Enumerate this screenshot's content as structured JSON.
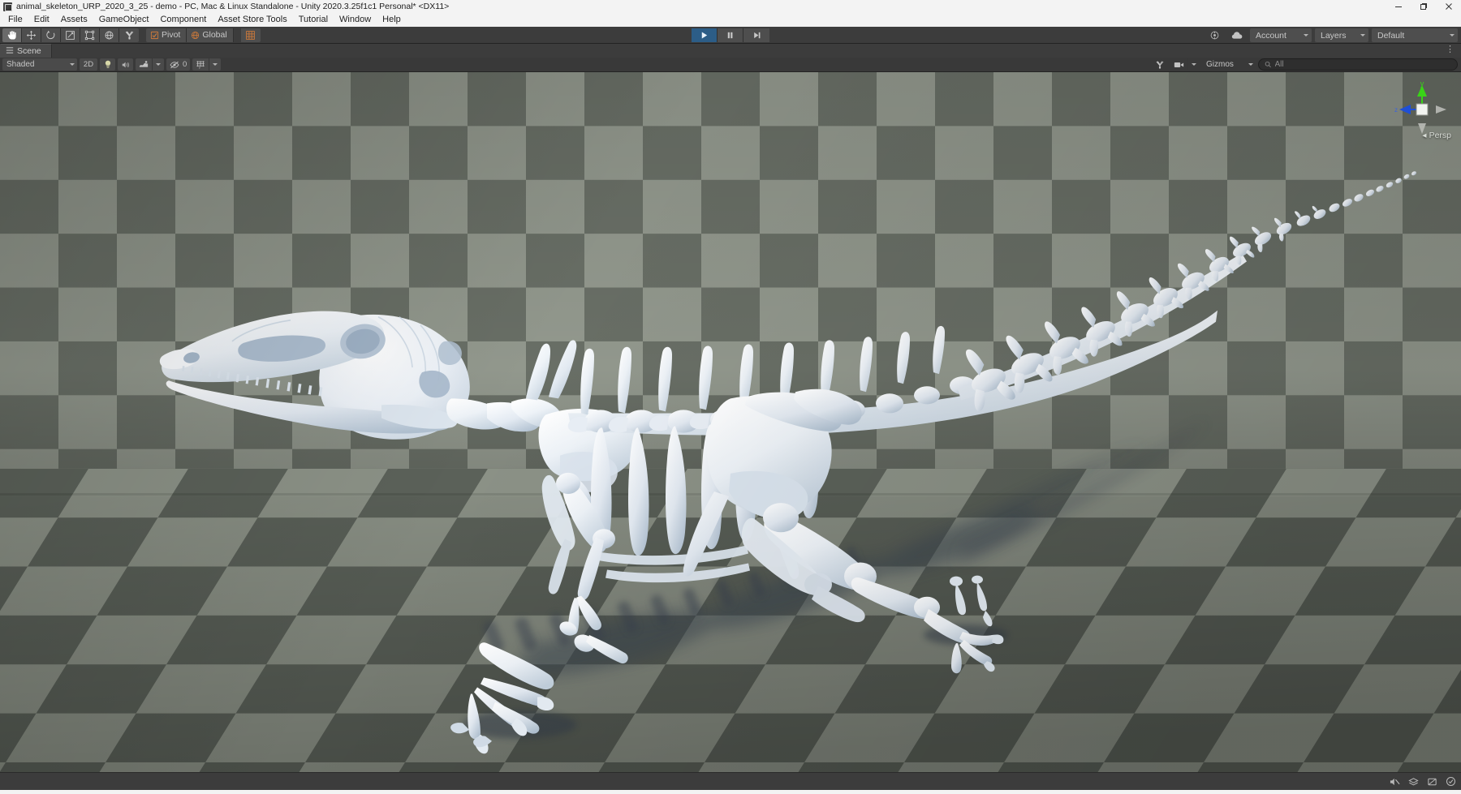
{
  "window": {
    "title": "animal_skeleton_URP_2020_3_25 - demo - PC, Mac & Linux Standalone - Unity 2020.3.25f1c1 Personal* <DX11>",
    "icon": "unity-app-icon",
    "minimize_label": "─",
    "maximize_label": "❐",
    "close_label": "✕"
  },
  "menubar": {
    "items": [
      {
        "label": "File"
      },
      {
        "label": "Edit"
      },
      {
        "label": "Assets"
      },
      {
        "label": "GameObject"
      },
      {
        "label": "Component"
      },
      {
        "label": "Asset Store Tools"
      },
      {
        "label": "Tutorial"
      },
      {
        "label": "Window"
      },
      {
        "label": "Help"
      }
    ]
  },
  "toolbar": {
    "tools": [
      {
        "name": "hand-tool",
        "icon": "hand-icon",
        "active": true
      },
      {
        "name": "move-tool",
        "icon": "move-icon",
        "active": false
      },
      {
        "name": "rotate-tool",
        "icon": "rotate-icon",
        "active": false
      },
      {
        "name": "scale-tool",
        "icon": "scale-icon",
        "active": false
      },
      {
        "name": "rect-tool",
        "icon": "rect-transform-icon",
        "active": false
      },
      {
        "name": "transform-tool",
        "icon": "transform-icon",
        "active": false
      },
      {
        "name": "custom-editor-tool",
        "icon": "wrench-icon",
        "active": false
      }
    ],
    "pivot_label": "Pivot",
    "handle_label": "Global",
    "snap_icon": "grid-snap-icon",
    "play_label": "Play",
    "pause_label": "Pause",
    "step_label": "Step",
    "play_active": true,
    "cloud_icon": "cloud-icon",
    "collab_icon": "collab-icon",
    "account_label": "Account",
    "layers_label": "Layers",
    "layout_label": "Default"
  },
  "scene_tab": {
    "label": "Scene",
    "icon": "scene-icon",
    "menu_icon": "kebab-menu-icon"
  },
  "scene_toolbar": {
    "draw_mode": "Shaded",
    "view_2d_label": "2D",
    "lighting_icon": "lightbulb-icon",
    "audio_icon": "audio-icon",
    "effects_icon": "effects-icon",
    "hidden_count": "0",
    "hidden_icon": "eye-off-icon",
    "grid_icon": "grid-icon",
    "tools_icon": "wrench-icon",
    "camera_icon": "camera-icon",
    "gizmos_label": "Gizmos",
    "search_placeholder": "All",
    "search_value": "",
    "search_icon": "search-icon"
  },
  "viewport": {
    "scene_name": "animal skeleton scene",
    "projection_label": "Persp",
    "projection_arrow": "◂",
    "lock_icon": "lock-icon",
    "gizmo": {
      "axis_y_label": "y",
      "axis_z_label": "z",
      "axis_y_color": "#39d417",
      "axis_z_color": "#1f4fd6",
      "axis_gray_color": "#b7bab4"
    },
    "colors": {
      "wall_light": "#959b90",
      "wall_dark": "#6b7168",
      "floor_light": "#878d82",
      "floor_dark": "#5b6159",
      "bone_light": "#fbfcfd",
      "bone_mid": "#dfe7ee",
      "bone_shadow": "#b8c6d4",
      "shadow": "#3c4452"
    },
    "model_label": "animal skeleton"
  },
  "statusbar": {
    "message": "",
    "icons": [
      {
        "name": "mute-audio-status-icon"
      },
      {
        "name": "layers-status-icon"
      },
      {
        "name": "blocked-status-icon"
      },
      {
        "name": "check-status-icon"
      }
    ]
  }
}
